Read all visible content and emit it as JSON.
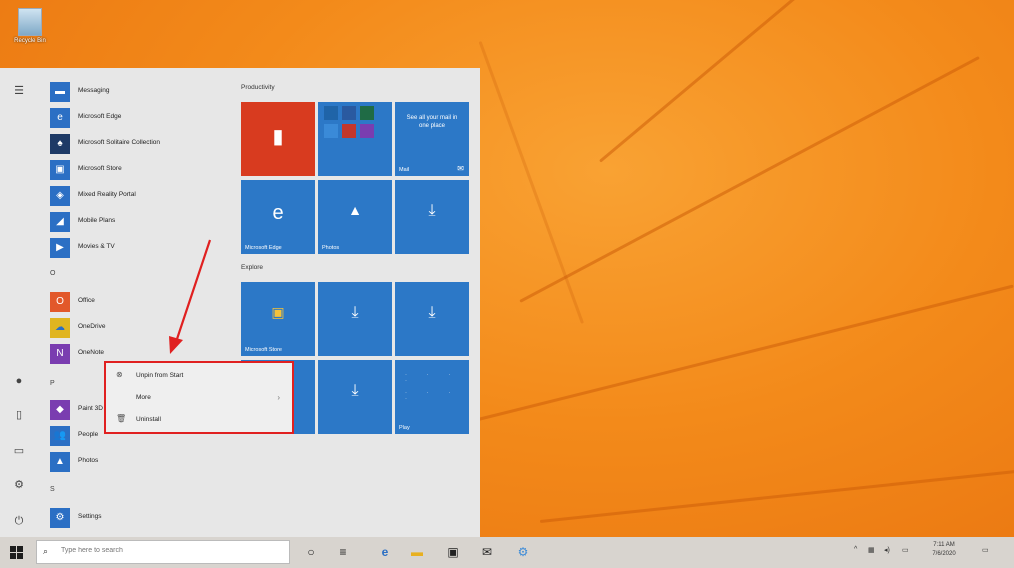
{
  "desktop": {
    "recycle_bin_label": "Recycle Bin"
  },
  "start": {
    "rail": [
      "hamburger-icon",
      "user-icon",
      "documents-icon",
      "pictures-icon",
      "settings-icon",
      "power-icon"
    ],
    "apps": [
      {
        "name": "Messaging",
        "icon": "messaging-icon",
        "color": "#2b6fc4"
      },
      {
        "name": "Microsoft Edge",
        "icon": "edge-icon",
        "color": "#2b6fc4"
      },
      {
        "name": "Microsoft Solitaire Collection",
        "icon": "solitaire-icon",
        "color": "#1e3a66"
      },
      {
        "name": "Microsoft Store",
        "icon": "store-icon",
        "color": "#2b6fc4"
      },
      {
        "name": "Mixed Reality Portal",
        "icon": "mixed-reality-icon",
        "color": "#2b6fc4"
      },
      {
        "name": "Mobile Plans",
        "icon": "mobile-plans-icon",
        "color": "#2b6fc4"
      },
      {
        "name": "Movies & TV",
        "icon": "movies-icon",
        "color": "#2b6fc4"
      }
    ],
    "letter_o": "O",
    "apps_o": [
      {
        "name": "Office",
        "icon": "office-icon",
        "color": "#e2582a"
      },
      {
        "name": "OneDrive",
        "icon": "onedrive-icon",
        "color": "#2b6fc4"
      },
      {
        "name": "OneNote",
        "icon": "onenote-icon",
        "color": "#7a3db0"
      }
    ],
    "letter_p": "P",
    "apps_p": [
      {
        "name": "Paint 3D",
        "icon": "paint3d-icon",
        "color": "#7a3db0"
      },
      {
        "name": "People",
        "icon": "people-icon",
        "color": "#2b6fc4"
      },
      {
        "name": "Photos",
        "icon": "photos-icon",
        "color": "#2b6fc4"
      }
    ],
    "letter_s": "S",
    "apps_s": [
      {
        "name": "Settings",
        "icon": "settings-app-icon",
        "color": "#2b6fc4"
      }
    ],
    "groups": {
      "productivity": "Productivity",
      "explore": "Explore"
    },
    "tiles": {
      "office": "Office",
      "mail_text": "See all your mail in one place",
      "mail": "Mail",
      "edge": "Microsoft Edge",
      "photos": "Photos",
      "store": "Microsoft Store",
      "play": "Play"
    }
  },
  "context_menu": {
    "items": [
      {
        "label": "Unpin from Start",
        "icon": "unpin-icon"
      },
      {
        "label": "More",
        "icon": ""
      },
      {
        "label": "Uninstall",
        "icon": "trash-icon"
      }
    ]
  },
  "taskbar": {
    "search_placeholder": "Type here to search",
    "time": "7:11 AM",
    "date": "7/6/2020"
  }
}
